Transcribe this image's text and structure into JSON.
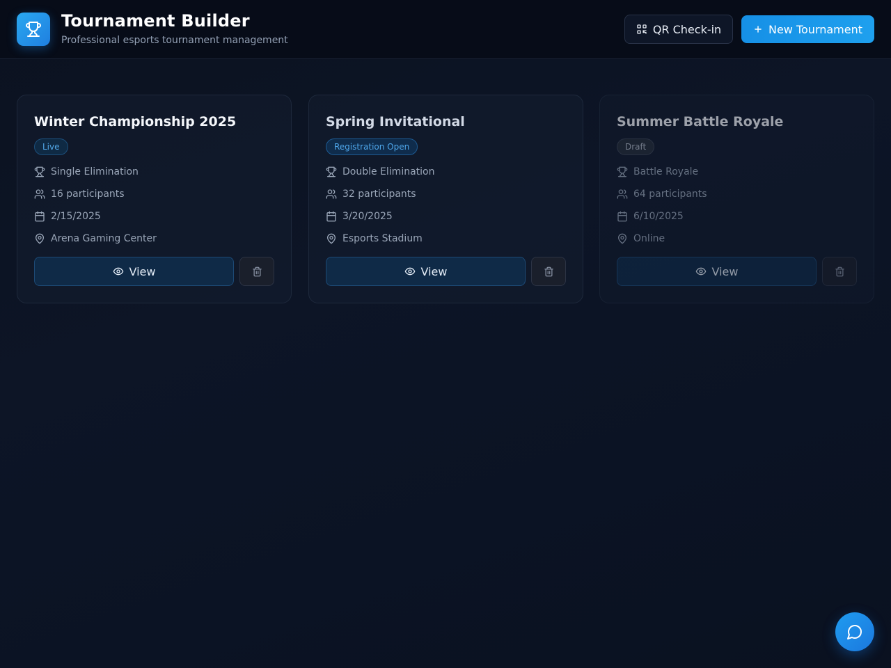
{
  "header": {
    "title": "Tournament Builder",
    "subtitle": "Professional esports tournament management",
    "logo_icon": "trophy-icon",
    "qr_button_label": "QR Check-in",
    "new_button_label": "New Tournament"
  },
  "tournaments": [
    {
      "title": "Winter Championship 2025",
      "status": "Live",
      "format": "Single Elimination",
      "participants": "16 participants",
      "date": "2/15/2025",
      "location": "Arena Gaming Center",
      "view_label": "View"
    },
    {
      "title": "Spring Invitational",
      "status": "Registration Open",
      "format": "Double Elimination",
      "participants": "32 participants",
      "date": "3/20/2025",
      "location": "Esports Stadium",
      "view_label": "View"
    },
    {
      "title": "Summer Battle Royale",
      "status": "Draft",
      "format": "Battle Royale",
      "participants": "64 participants",
      "date": "6/10/2025",
      "location": "Online",
      "view_label": "View"
    }
  ],
  "colors": {
    "accent": "#1e9cf0",
    "live": "#52a8e8",
    "registration": "#4ea6ea",
    "draft": "#b4bcc9"
  },
  "chat_icon": "chat-bubble-icon"
}
